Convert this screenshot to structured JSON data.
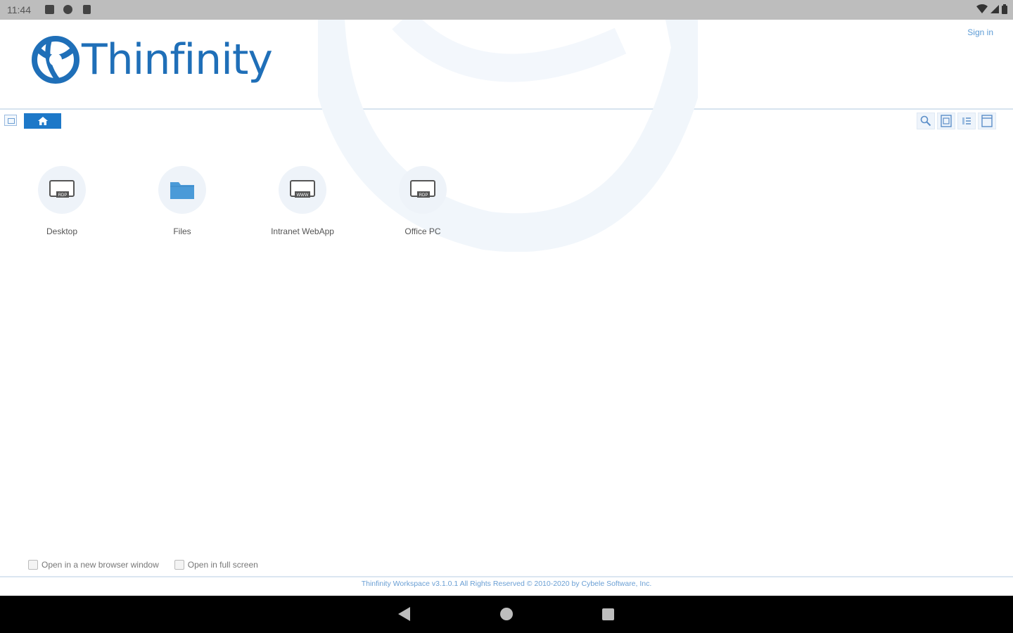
{
  "status_bar": {
    "time": "11:44",
    "icons": [
      "notification-icon",
      "sync-icon",
      "sd-card-icon"
    ],
    "right_icons": [
      "wifi-icon",
      "signal-icon",
      "battery-icon"
    ]
  },
  "header": {
    "brand": "Thinfinity",
    "sign_in": "Sign in"
  },
  "toolbar": {
    "active_tab_icon": "home-icon",
    "tools": [
      "search-icon",
      "grid-view-icon",
      "list-view-icon",
      "detail-view-icon"
    ]
  },
  "apps": [
    {
      "label": "Desktop",
      "icon": "rdp-monitor-icon",
      "badge": "RDP"
    },
    {
      "label": "Files",
      "icon": "folder-icon",
      "badge": ""
    },
    {
      "label": "Intranet WebApp",
      "icon": "web-monitor-icon",
      "badge": "WWW"
    },
    {
      "label": "Office PC",
      "icon": "rdp-monitor-icon",
      "badge": "RDP"
    }
  ],
  "options": {
    "new_window": "Open in a new browser window",
    "full_screen": "Open in full screen"
  },
  "footer": {
    "copyright": "Thinfinity Workspace v3.1.0.1 All Rights Reserved © 2010-2020 by Cybele Software, Inc."
  },
  "colors": {
    "brand_blue": "#1f6fb8",
    "tab_blue": "#1d78c8",
    "folder_blue": "#4a9ad8"
  }
}
